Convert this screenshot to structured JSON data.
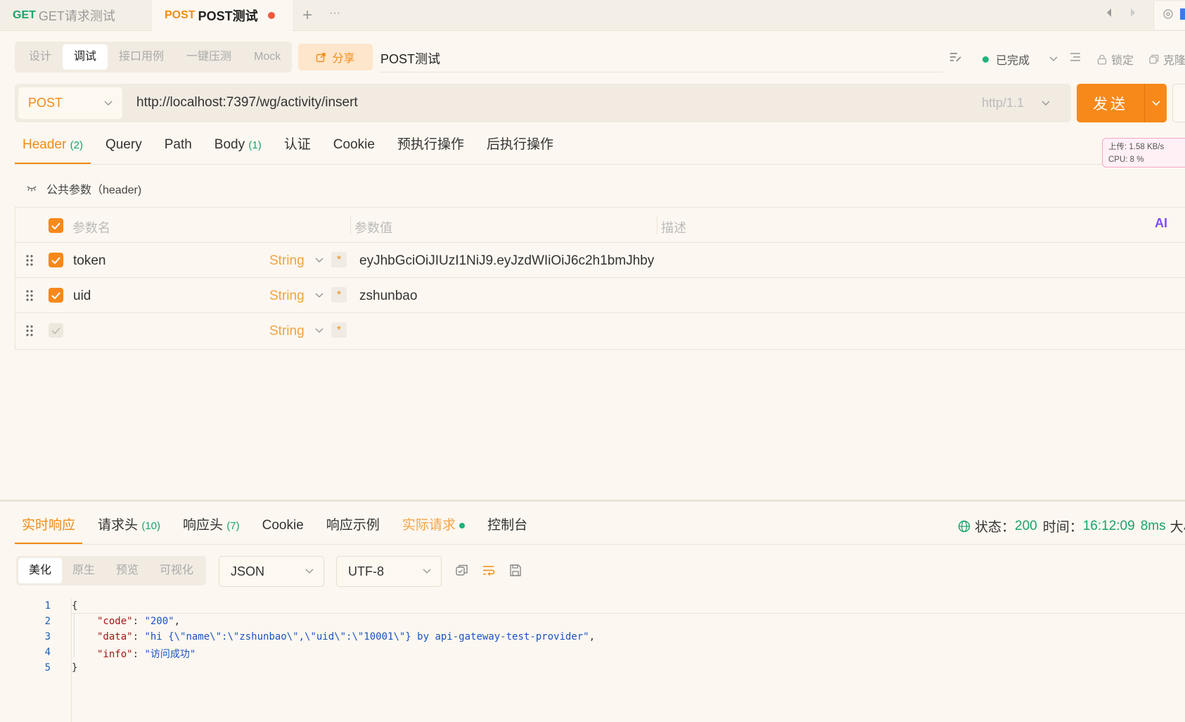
{
  "tabs": [
    {
      "method": "GET",
      "title": "GET请求测试",
      "active": false
    },
    {
      "method": "POST",
      "title": "POST测试",
      "active": true,
      "unsaved": true
    }
  ],
  "tabstrip": {
    "add_label": "+",
    "more_label": "···"
  },
  "modes": [
    "设计",
    "调试",
    "接口用例",
    "一键压测",
    "Mock"
  ],
  "active_mode": "调试",
  "share_label": "分享",
  "doc_title": "POST测试",
  "status_text": "已完成",
  "lock_label": "锁定",
  "clone_label": "克隆",
  "request": {
    "method": "POST",
    "url": "http://localhost:7397/wg/activity/insert",
    "http_version": "http/1.1",
    "send_label": "发送"
  },
  "request_tabs": [
    {
      "label": "Header",
      "count": "(2)"
    },
    {
      "label": "Query",
      "count": ""
    },
    {
      "label": "Path",
      "count": ""
    },
    {
      "label": "Body",
      "count": "(1)"
    },
    {
      "label": "认证",
      "count": ""
    },
    {
      "label": "Cookie",
      "count": ""
    },
    {
      "label": "预执行操作",
      "count": ""
    },
    {
      "label": "后执行操作",
      "count": ""
    }
  ],
  "net_monitor": {
    "upload": "上传: 1.58 KB/s",
    "cpu": "CPU: 8 %"
  },
  "public_params_label": "公共参数（header)",
  "params_table": {
    "headers": {
      "name": "参数名",
      "value": "参数值",
      "desc": "描述"
    },
    "ai_label": "AI",
    "rows": [
      {
        "name": "token",
        "type": "String",
        "required_mark": "*",
        "value": "eyJhbGciOiJIUzI1NiJ9.eyJzdWIiOiJ6c2h1bmJhby",
        "checked": true
      },
      {
        "name": "uid",
        "type": "String",
        "required_mark": "*",
        "value": "zshunbao",
        "checked": true
      },
      {
        "name": "",
        "type": "String",
        "required_mark": "*",
        "value": "",
        "checked": false
      }
    ]
  },
  "response_tabs": [
    {
      "label": "实时响应",
      "count": ""
    },
    {
      "label": "请求头",
      "count": "(10)"
    },
    {
      "label": "响应头",
      "count": "(7)"
    },
    {
      "label": "Cookie",
      "count": ""
    },
    {
      "label": "响应示例",
      "count": ""
    },
    {
      "label": "实际请求",
      "count": ""
    },
    {
      "label": "控制台",
      "count": ""
    }
  ],
  "response_status": {
    "status_label": "状态：",
    "status": "200",
    "time_label": "时间：",
    "time": "16:12:09",
    "duration": "8ms",
    "size_label": "大小"
  },
  "view_modes": [
    "美化",
    "原生",
    "预览",
    "可视化"
  ],
  "format": "JSON",
  "encoding": "UTF-8",
  "code_lines": [
    {
      "n": "1",
      "text": "{"
    },
    {
      "n": "2",
      "key": "\"code\"",
      "val": "\"200\"",
      "tail": ","
    },
    {
      "n": "3",
      "key": "\"data\"",
      "val": "\"hi {\\\"name\\\":\\\"zshunbao\\\",\\\"uid\\\":\\\"10001\\\"} by api-gateway-test-provider\"",
      "tail": ","
    },
    {
      "n": "4",
      "key": "\"info\"",
      "val": "\"访问成功\"",
      "tail": ""
    },
    {
      "n": "5",
      "text": "}"
    }
  ],
  "colors": {
    "accent": "#f7891a",
    "green": "#17a46b",
    "bg": "#fcf7f0"
  }
}
